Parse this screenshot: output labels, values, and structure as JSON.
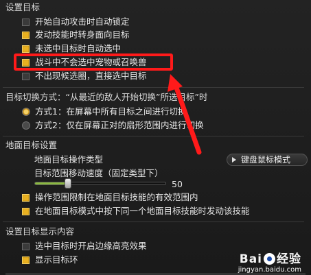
{
  "section_target": {
    "title": "设置目标",
    "options": [
      {
        "label": "开始自动攻击时自动锁定",
        "checked": false
      },
      {
        "label": "发动技能时转身面向目标",
        "checked": true
      },
      {
        "label": "未选中目标时自动选中",
        "checked": true
      },
      {
        "label": "战斗中不会选中宠物或召唤兽",
        "checked": true
      },
      {
        "label": "不出现候选圈，直接选中目标",
        "checked": false
      }
    ]
  },
  "section_switch": {
    "title": "目标切换方式：“从最近的敌人开始切换”所选目标”时",
    "modes": [
      {
        "label": "方式1：在屏幕中所有目标之间进行切换",
        "selected": true
      },
      {
        "label": "方式2：仅在屏幕正对的扇形范围内进行切换",
        "selected": false
      }
    ]
  },
  "section_ground": {
    "title": "地面目标设置",
    "operation_type_label": "地面目标操作类型",
    "dropdown_value": "键盘鼠标模式",
    "speed_label": "目标范围移动速度（固定类型下）",
    "slider_value": "50",
    "slider_fraction": 0.25,
    "options": [
      {
        "label": "操作范围限制在地面目标技能的有效范围内",
        "checked": true
      },
      {
        "label": "在地面目标模式中按下同一个地面目标技能时发动该技能",
        "checked": true
      }
    ]
  },
  "section_display": {
    "title": "设置目标显示内容",
    "options": [
      {
        "label": "选中目标时开启边缘高亮效果",
        "checked": false
      },
      {
        "label": "显示目标环",
        "checked": true
      }
    ]
  },
  "watermark": {
    "main_left": "Bai",
    "main_right": "经验",
    "sub": "jingyan.baidu.com"
  },
  "colors": {
    "checkbox_on": "#e8b020",
    "highlight": "#ff1a1a"
  },
  "icons": {
    "dropdown": "triangle-right-icon",
    "annotation": "red-arrow-icon",
    "watermark": "baidu-paw-icon"
  }
}
